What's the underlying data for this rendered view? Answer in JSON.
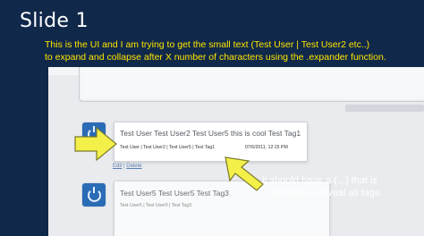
{
  "slide": {
    "title": "Slide 1",
    "subtitle_line1": "This is the UI and I am trying to get the small text (Test User | Test User2 etc..)",
    "subtitle_line2": "to expand and collapse after X number of characters using the .expander function."
  },
  "post1": {
    "title": "Test User Test User2 Test User5 this is cool Test Tag1",
    "tags": "Test User | Test User2 | Test User5 | Test Tag1",
    "date": "07/6/2011, 12:15 PM",
    "edit_label": "Edit",
    "separator": "|",
    "delete_label": "Delete"
  },
  "post2": {
    "title": "Test User5 Test User5 Test Tag3",
    "tags": "Test User5 | Test User5 | Test Tag3"
  },
  "annotation": {
    "line1": "it should have a (...) that is",
    "line2": "clickable to reveal all tags."
  },
  "colors": {
    "background": "#10284a",
    "subtitle": "#ffe600",
    "arrow": "#f4f04a"
  }
}
